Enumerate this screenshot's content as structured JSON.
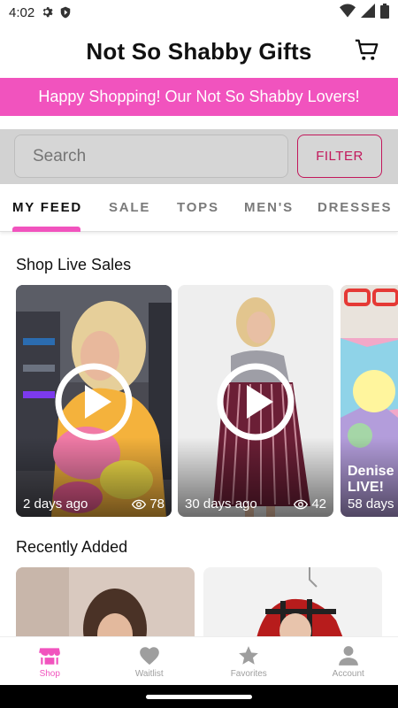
{
  "status_bar": {
    "time": "4:02",
    "icons": [
      "gear-icon",
      "shield-icon",
      "wifi-icon",
      "signal-icon",
      "battery-icon"
    ]
  },
  "header": {
    "title": "Not So Shabby Gifts",
    "cart_icon": "cart-icon"
  },
  "banner": {
    "text": "Happy Shopping! Our Not So Shabby Lovers!",
    "color": "#f153be"
  },
  "search": {
    "placeholder": "Search",
    "filter_label": "FILTER"
  },
  "tabs": [
    {
      "label": "MY FEED",
      "active": true
    },
    {
      "label": "SALE",
      "active": false
    },
    {
      "label": "TOPS",
      "active": false
    },
    {
      "label": "MEN'S",
      "active": false
    },
    {
      "label": "DRESSES",
      "active": false
    }
  ],
  "live_sales": {
    "title": "Shop Live Sales",
    "cards": [
      {
        "time": "2 days ago",
        "views": "78"
      },
      {
        "time": "30 days ago",
        "views": "42"
      },
      {
        "title": "Denise LIVE!",
        "time": "58 days"
      }
    ]
  },
  "recently_added": {
    "title": "Recently Added"
  },
  "bottom_nav": [
    {
      "label": "Shop",
      "icon": "store-icon",
      "active": true
    },
    {
      "label": "Waitlist",
      "icon": "heart-icon",
      "active": false
    },
    {
      "label": "Favorites",
      "icon": "star-icon",
      "active": false
    },
    {
      "label": "Account",
      "icon": "person-icon",
      "active": false
    }
  ],
  "colors": {
    "accent": "#f153be",
    "filter": "#c2185b"
  }
}
